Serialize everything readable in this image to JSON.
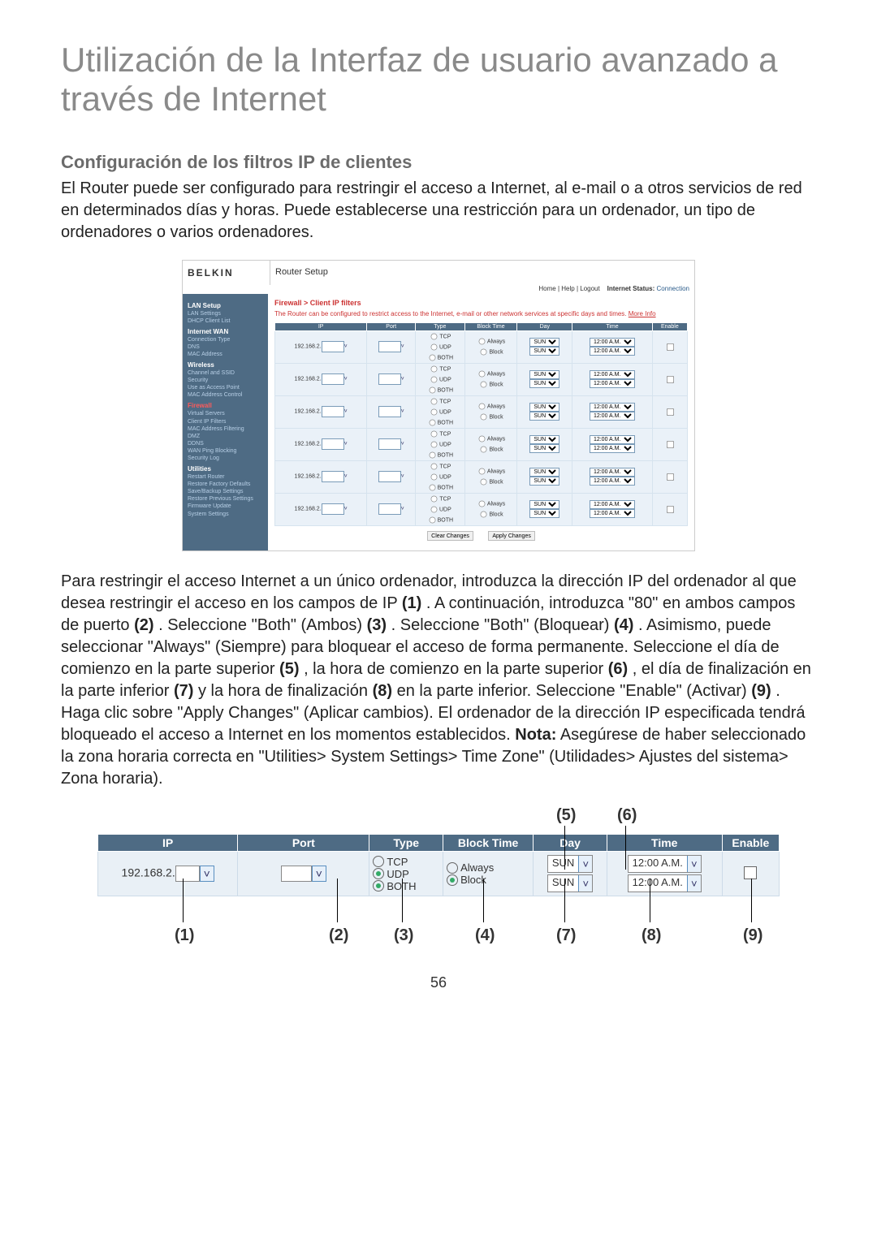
{
  "page_title": "Utilización de la Interfaz de usuario avanzado a través de Internet",
  "section_title": "Configuración de los filtros IP de clientes",
  "intro": "El Router puede ser configurado para restringir el acceso a Internet, al e-mail o a otros servicios de red en determinados días y horas. Puede establecerse una restricción para un ordenador, un tipo de ordenadores o varios ordenadores.",
  "router": {
    "brand": "BELKIN",
    "top_title": "Router Setup",
    "top_links": {
      "home": "Home",
      "help": "Help",
      "logout": "Logout",
      "status_label": "Internet Status:",
      "status_value": "Connection"
    },
    "sidebar": {
      "groups": [
        {
          "label": "LAN Setup",
          "items": [
            "LAN Settings",
            "DHCP Client List"
          ]
        },
        {
          "label": "Internet WAN",
          "items": [
            "Connection Type",
            "DNS",
            "MAC Address"
          ]
        },
        {
          "label": "Wireless",
          "items": [
            "Channel and SSID",
            "Security",
            "Use as Access Point",
            "MAC Address Control"
          ]
        },
        {
          "label": "Firewall",
          "red": true,
          "items": [
            "Virtual Servers",
            "Client IP Filters",
            "MAC Address Filtering",
            "DMZ",
            "DDNS",
            "WAN Ping Blocking",
            "Security Log"
          ]
        },
        {
          "label": "Utilities",
          "items": [
            "Restart Router",
            "Restore Factory Defaults",
            "Save/Backup Settings",
            "Restore Previous Settings",
            "Firmware Update",
            "System Settings"
          ]
        }
      ]
    },
    "breadcrumb": "Firewall > Client IP filters",
    "description": "The Router can be configured to restrict access to the Internet, e-mail or other network services at specific days and times.",
    "more_info": "More Info",
    "table": {
      "headers": [
        "IP",
        "Port",
        "Type",
        "Block Time",
        "Day",
        "Time",
        "Enable"
      ],
      "ip_prefix": "192.168.2.",
      "types": [
        "TCP",
        "UDP",
        "BOTH"
      ],
      "block_times": [
        "Always",
        "Block"
      ],
      "day_option": "SUN",
      "time_option": "12:00 A.M.",
      "row_count": 6
    },
    "buttons": {
      "clear": "Clear Changes",
      "apply": "Apply Changes"
    }
  },
  "instructions": {
    "frag1": "Para restringir el acceso Internet a un único ordenador, introduzca la dirección IP del ordenador al que desea restringir el acceso en los campos de IP ",
    "b1": "(1)",
    "frag2": ". A continuación, introduzca \"80\" en ambos campos de puerto ",
    "b2": "(2)",
    "frag3": ". Seleccione \"Both\" (Ambos) ",
    "b3": "(3)",
    "frag4": ". Seleccione \"Both\" (Bloquear) ",
    "b4": "(4)",
    "frag5": ". Asimismo, puede seleccionar \"Always\" (Siempre) para bloquear el acceso de forma permanente. Seleccione el día de comienzo en la parte superior ",
    "b5": "(5)",
    "frag6": ", la hora de comienzo en la parte superior ",
    "b6": "(6)",
    "frag7": ", el día de finalización en la parte inferior ",
    "b7": "(7)",
    "frag8": " y la hora de finalización ",
    "b8": "(8)",
    "frag9": " en la parte inferior. Seleccione \"Enable\" (Activar) ",
    "b9": "(9)",
    "frag10": ". Haga clic sobre \"Apply Changes\" (Aplicar cambios). El ordenador de la dirección IP especificada tendrá bloqueado el acceso a Internet en los momentos establecidos. ",
    "bnote": "Nota:",
    "frag11": " Asegúrese de haber seleccionado la zona horaria correcta en \"Utilities> System Settings> Time Zone\" (Utilidades> Ajustes del sistema> Zona horaria)."
  },
  "detail": {
    "headers": {
      "ip": "IP",
      "port": "Port",
      "type": "Type",
      "block_time": "Block Time",
      "day": "Day",
      "time": "Time",
      "enable": "Enable"
    },
    "ip_prefix": "192.168.2.",
    "types": {
      "tcp": "TCP",
      "udp": "UDP",
      "both": "BOTH"
    },
    "block": {
      "always": "Always",
      "block": "Block"
    },
    "day": "SUN",
    "time": "12:00 A.M.",
    "callouts": {
      "c1": "(1)",
      "c2": "(2)",
      "c3": "(3)",
      "c4": "(4)",
      "c5": "(5)",
      "c6": "(6)",
      "c7": "(7)",
      "c8": "(8)",
      "c9": "(9)"
    }
  },
  "page_number": "56"
}
